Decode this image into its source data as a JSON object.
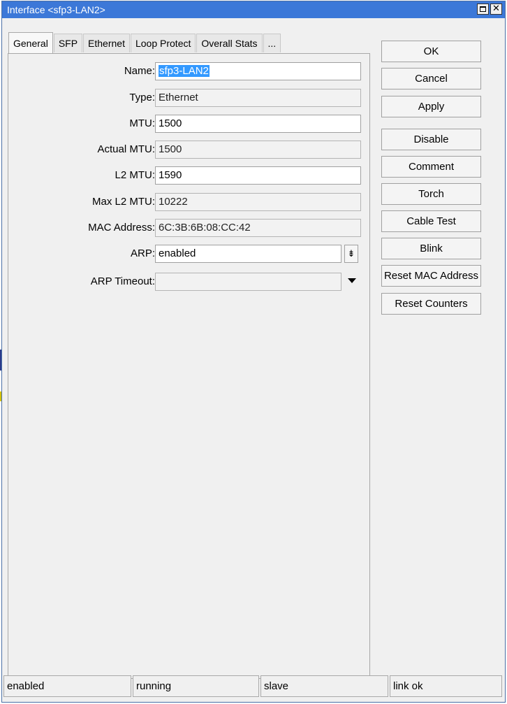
{
  "window": {
    "title": "Interface <sfp3-LAN2>",
    "accent_color": "#3c78d8",
    "maximize_icon": "maximize-icon",
    "close_icon": "close-icon",
    "close_glyph": "✕"
  },
  "tabs": [
    {
      "label": "General",
      "active": true
    },
    {
      "label": "SFP"
    },
    {
      "label": "Ethernet"
    },
    {
      "label": "Loop Protect"
    },
    {
      "label": "Overall Stats"
    },
    {
      "label": "..."
    }
  ],
  "form": {
    "name": {
      "label": "Name:",
      "value": "sfp3-LAN2"
    },
    "type": {
      "label": "Type:",
      "value": "Ethernet"
    },
    "mtu": {
      "label": "MTU:",
      "value": "1500"
    },
    "actual_mtu": {
      "label": "Actual MTU:",
      "value": "1500"
    },
    "l2_mtu": {
      "label": "L2 MTU:",
      "value": "1590"
    },
    "max_l2_mtu": {
      "label": "Max L2 MTU:",
      "value": "10222"
    },
    "mac_address": {
      "label": "MAC Address:",
      "value": "6C:3B:6B:08:CC:42"
    },
    "arp": {
      "label": "ARP:",
      "value": "enabled",
      "dropdown_glyph": "⇟"
    },
    "arp_timeout": {
      "label": "ARP Timeout:",
      "value": ""
    }
  },
  "buttons": {
    "ok": "OK",
    "cancel": "Cancel",
    "apply": "Apply",
    "disable": "Disable",
    "comment": "Comment",
    "torch": "Torch",
    "cable_test": "Cable Test",
    "blink": "Blink",
    "reset_mac": "Reset MAC Address",
    "reset_counters": "Reset Counters"
  },
  "status": [
    "enabled",
    "running",
    "slave",
    "link ok"
  ]
}
